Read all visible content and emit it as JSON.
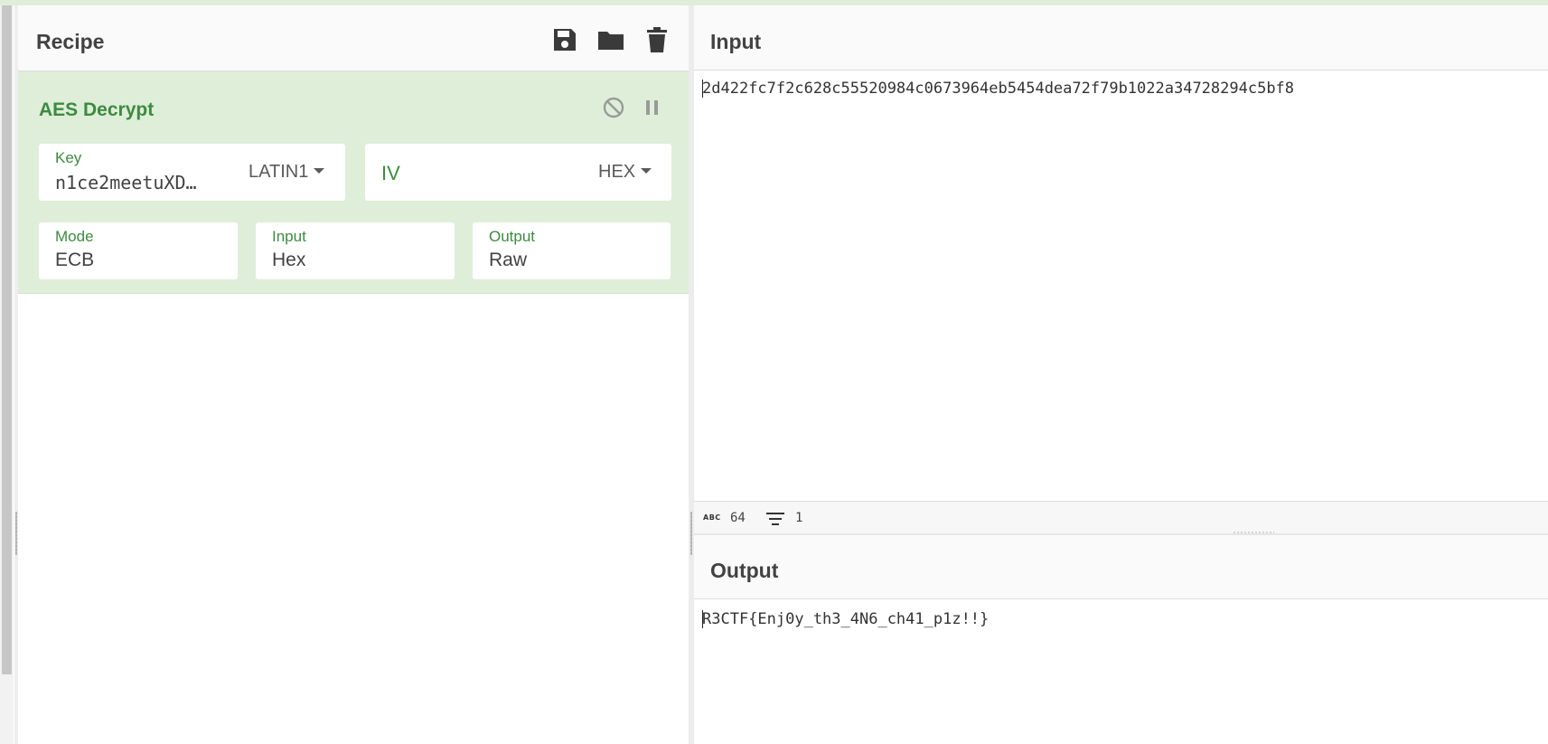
{
  "recipe": {
    "title": "Recipe",
    "header_icons": [
      "save-icon",
      "folder-icon",
      "trash-icon"
    ],
    "operation": {
      "title": "AES Decrypt",
      "controls": [
        "disable-icon",
        "pause-icon"
      ],
      "key": {
        "label": "Key",
        "value": "n1ce2meetuXD…",
        "encoding": "LATIN1"
      },
      "iv": {
        "placeholder": "IV",
        "encoding": "HEX"
      },
      "mode": {
        "label": "Mode",
        "value": "ECB"
      },
      "input": {
        "label": "Input",
        "value": "Hex"
      },
      "output": {
        "label": "Output",
        "value": "Raw"
      }
    }
  },
  "input_pane": {
    "title": "Input",
    "text": "2d422fc7f2c628c55520984c0673964eb5454dea72f79b1022a34728294c5bf8",
    "status": {
      "char_count": "64",
      "line_count": "1"
    }
  },
  "output_pane": {
    "title": "Output",
    "text": "R3CTF{Enj0y_th3_4N6_ch41_p1z!!}"
  },
  "colors": {
    "accent_green": "#3d8b40",
    "operation_bg": "#dfeed9",
    "header_bg": "#fafafa",
    "icon_dark": "#3a3a3a"
  }
}
